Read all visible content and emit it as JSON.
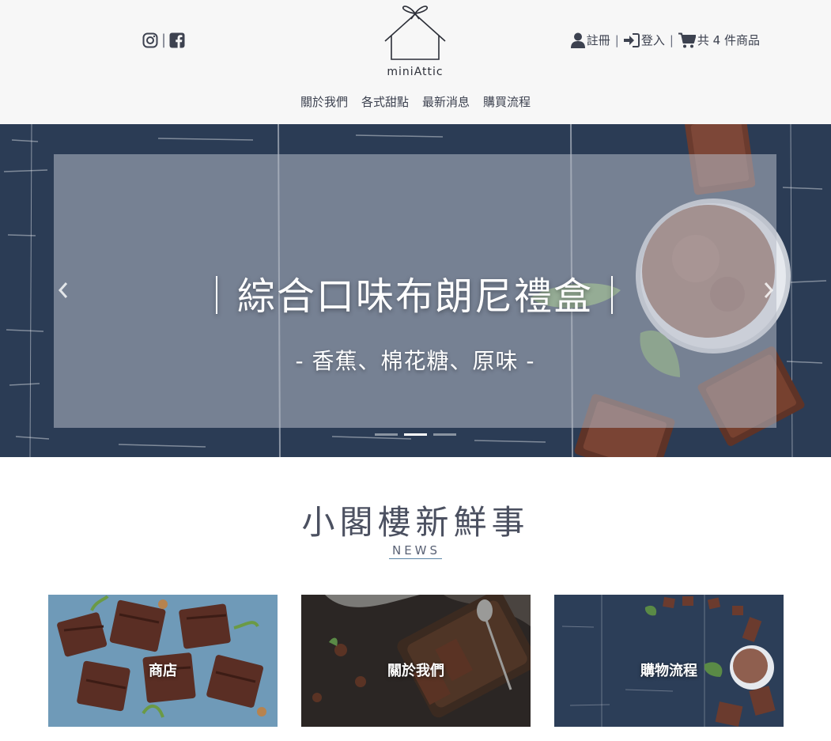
{
  "header": {
    "social": {
      "instagram_icon": "instagram-icon",
      "facebook_icon": "facebook-icon",
      "separator": "|"
    },
    "logo_text": "miniAttic",
    "account": {
      "register_label": "註冊",
      "login_label": "登入",
      "cart_label": "共 4 件商品",
      "separator": "|"
    },
    "nav": [
      "關於我們",
      "各式甜點",
      "最新消息",
      "購買流程"
    ]
  },
  "hero": {
    "title": "｜綜合口味布朗尼禮盒｜",
    "subtitle": "- 香蕉、棉花糖、原味 -",
    "slide_count": 3,
    "active_slide": 1
  },
  "news": {
    "title": "小閣樓新鮮事",
    "subtitle": "NEWS"
  },
  "cards": [
    {
      "label": "商店"
    },
    {
      "label": "關於我們"
    },
    {
      "label": "購物流程"
    }
  ],
  "colors": {
    "header_bg": "#f7f7f7",
    "text": "#3d4250",
    "hero_bg": "#2d3e57",
    "accent_underline": "#5a84a6"
  }
}
